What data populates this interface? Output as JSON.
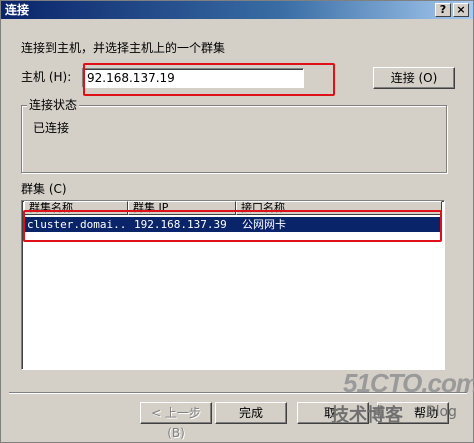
{
  "window": {
    "title": "连接",
    "help_glyph": "?",
    "close_glyph": "×"
  },
  "instruction": "连接到主机，并选择主机上的一个群集",
  "host": {
    "label": "主机 (H):",
    "value": "92.168.137.19",
    "connect_button": "连接 (O)"
  },
  "status": {
    "title": "连接状态",
    "text": "已连接"
  },
  "cluster": {
    "label": "群集 (C)",
    "columns": [
      "群集名称",
      "群集 IP",
      "接口名称"
    ],
    "rows": [
      {
        "name": "cluster.domai...",
        "ip": "192.168.137.39",
        "iface": "公网网卡"
      }
    ]
  },
  "buttons": {
    "back": "< 上一步 (B)",
    "finish": "完成",
    "cancel": "取",
    "help": "帮助"
  },
  "watermark": {
    "site": "51CTO.com",
    "tagline": "技术博客",
    "suffix": "Blog"
  },
  "colors": {
    "title_start": "#0a246a",
    "selection": "#0a246a",
    "highlight_box": "#e0101a"
  }
}
